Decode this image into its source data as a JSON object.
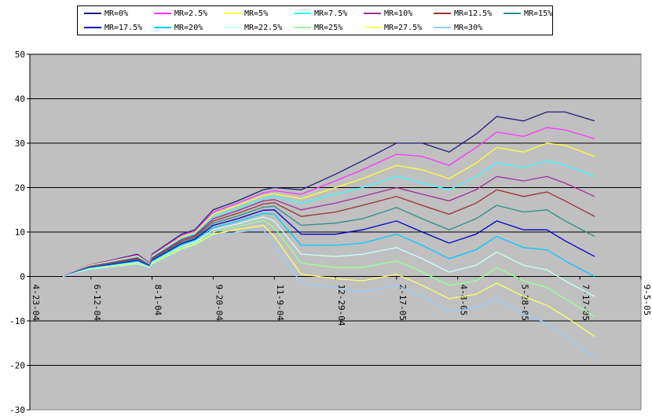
{
  "chart_data": {
    "type": "line",
    "title": "",
    "xlabel": "",
    "ylabel": "",
    "ylim": [
      -30,
      50
    ],
    "yticks": [
      -30,
      -20,
      -10,
      0,
      10,
      20,
      30,
      40,
      50
    ],
    "xlim": [
      "2004-04-23",
      "2005-09-05"
    ],
    "xtick_labels": [
      "4-23-04",
      "6-12-04",
      "8-1-04",
      "9-20-04",
      "11-9-04",
      "12-29-04",
      "2-17-05",
      "4-8-05",
      "5-28-05",
      "7-17-05",
      "9-5-05"
    ],
    "xtick_dates": [
      "2004-04-23",
      "2004-06-12",
      "2004-08-01",
      "2004-09-20",
      "2004-11-09",
      "2004-12-29",
      "2005-02-17",
      "2005-04-08",
      "2005-05-28",
      "2005-07-17",
      "2005-09-05"
    ],
    "grid": true,
    "legend_position": "top",
    "plot_background": "#c0c0c0",
    "x": [
      "2004-05-20",
      "2004-06-10",
      "2004-07-20",
      "2004-07-30",
      "2004-08-01",
      "2004-08-25",
      "2004-09-05",
      "2004-09-20",
      "2004-10-10",
      "2004-10-31",
      "2004-11-09",
      "2004-12-01",
      "2004-12-29",
      "2005-01-20",
      "2005-02-17",
      "2005-03-10",
      "2005-04-01",
      "2005-04-23",
      "2005-05-10",
      "2005-06-01",
      "2005-06-20",
      "2005-07-05",
      "2005-07-29"
    ],
    "series": [
      {
        "name": "MR=0%",
        "color": "#1f1f7a",
        "values": [
          0,
          2.5,
          5,
          3,
          5,
          9.5,
          10.5,
          15,
          17,
          19.5,
          20,
          19.5,
          23,
          26,
          30,
          30,
          28,
          32,
          36,
          35,
          37,
          37,
          35
        ]
      },
      {
        "name": "MR=2.5%",
        "color": "#ff33ff",
        "values": [
          0,
          2.5,
          4.8,
          2.9,
          4.8,
          9.2,
          10.2,
          14.5,
          16.5,
          18.8,
          19.3,
          18.5,
          21.5,
          24,
          27.5,
          27,
          25,
          29,
          32.5,
          31.5,
          33.5,
          33,
          31
        ]
      },
      {
        "name": "MR=5%",
        "color": "#ffff33",
        "values": [
          0,
          2.4,
          4.6,
          2.8,
          4.6,
          8.9,
          9.9,
          14,
          16,
          18.2,
          18.6,
          17.5,
          20,
          22,
          25,
          24,
          22,
          25.5,
          29,
          28,
          30,
          29.5,
          27
        ]
      },
      {
        "name": "MR=7.5%",
        "color": "#33ffff",
        "values": [
          0,
          2.3,
          4.4,
          2.7,
          4.4,
          8.6,
          9.6,
          13.5,
          15.4,
          17.6,
          18,
          16.5,
          18.5,
          20,
          22.5,
          21,
          19.5,
          22.5,
          25.5,
          24.5,
          26,
          25,
          22.5
        ]
      },
      {
        "name": "MR=10%",
        "color": "#993399",
        "values": [
          0,
          2.2,
          4.2,
          2.6,
          4.2,
          8.3,
          9.3,
          13,
          14.8,
          17,
          17.3,
          15,
          16.5,
          18,
          20,
          18.5,
          17,
          19.5,
          22.5,
          21.5,
          22.5,
          21,
          18
        ]
      },
      {
        "name": "MR=12.5%",
        "color": "#993333",
        "values": [
          0,
          2.1,
          4,
          2.5,
          4,
          8,
          9,
          12.5,
          14.2,
          16.3,
          16.6,
          13.5,
          14.5,
          16,
          18,
          16,
          14,
          16.5,
          19.5,
          18,
          19,
          17,
          13.5
        ]
      },
      {
        "name": "MR=15%",
        "color": "#2e8b8b",
        "values": [
          0,
          2,
          3.8,
          2.4,
          3.8,
          7.7,
          8.7,
          12,
          13.6,
          15.6,
          15.8,
          11.5,
          12,
          13,
          15.5,
          13,
          10.5,
          13,
          16,
          14.5,
          15,
          12.5,
          9
        ]
      },
      {
        "name": "MR=17.5%",
        "color": "#0000cc",
        "values": [
          0,
          1.9,
          3.6,
          2.3,
          3.6,
          7.4,
          8.4,
          11.5,
          13,
          14.9,
          15,
          9.5,
          9.5,
          10.5,
          12.5,
          10,
          7.5,
          9.5,
          12.5,
          10.5,
          10.5,
          8,
          4.5
        ]
      },
      {
        "name": "MR=20%",
        "color": "#00ccff",
        "values": [
          0,
          1.8,
          3.4,
          2.2,
          3.4,
          7.1,
          8.1,
          11,
          12.4,
          14.2,
          14,
          7,
          7,
          7.5,
          9.5,
          7,
          4,
          6,
          9,
          6.5,
          6,
          3.5,
          0
        ]
      },
      {
        "name": "MR=22.5%",
        "color": "#ccffff",
        "values": [
          0,
          1.7,
          3.2,
          2.1,
          3.2,
          6.8,
          7.8,
          10.5,
          11.8,
          13.4,
          12.5,
          5,
          4.5,
          5,
          6.5,
          4,
          1,
          2.5,
          5.5,
          2.5,
          1.5,
          -1,
          -4.5
        ]
      },
      {
        "name": "MR=25%",
        "color": "#99ff99",
        "values": [
          0,
          1.6,
          3,
          2,
          3,
          6.5,
          7.5,
          10,
          11.2,
          12.6,
          11,
          3,
          2,
          2,
          3.5,
          1,
          -2,
          -1,
          2,
          -1,
          -2.5,
          -5,
          -9
        ]
      },
      {
        "name": "MR=27.5%",
        "color": "#ffff66",
        "values": [
          0,
          1.5,
          2.8,
          1.9,
          2.8,
          6.2,
          7.2,
          9.5,
          10.6,
          11.5,
          9,
          0.5,
          -0.5,
          -1,
          0.5,
          -2,
          -5,
          -4,
          -1.5,
          -4.5,
          -6.5,
          -9,
          -13.5
        ]
      },
      {
        "name": "MR=30%",
        "color": "#99ccff",
        "values": [
          0,
          1.4,
          2.6,
          1.8,
          2.6,
          5.9,
          6.9,
          9,
          10,
          10.5,
          7,
          -1.5,
          -2.5,
          -3.5,
          -2,
          -4.5,
          -8,
          -7,
          -5,
          -8.5,
          -10.5,
          -13.5,
          -18
        ]
      }
    ]
  }
}
